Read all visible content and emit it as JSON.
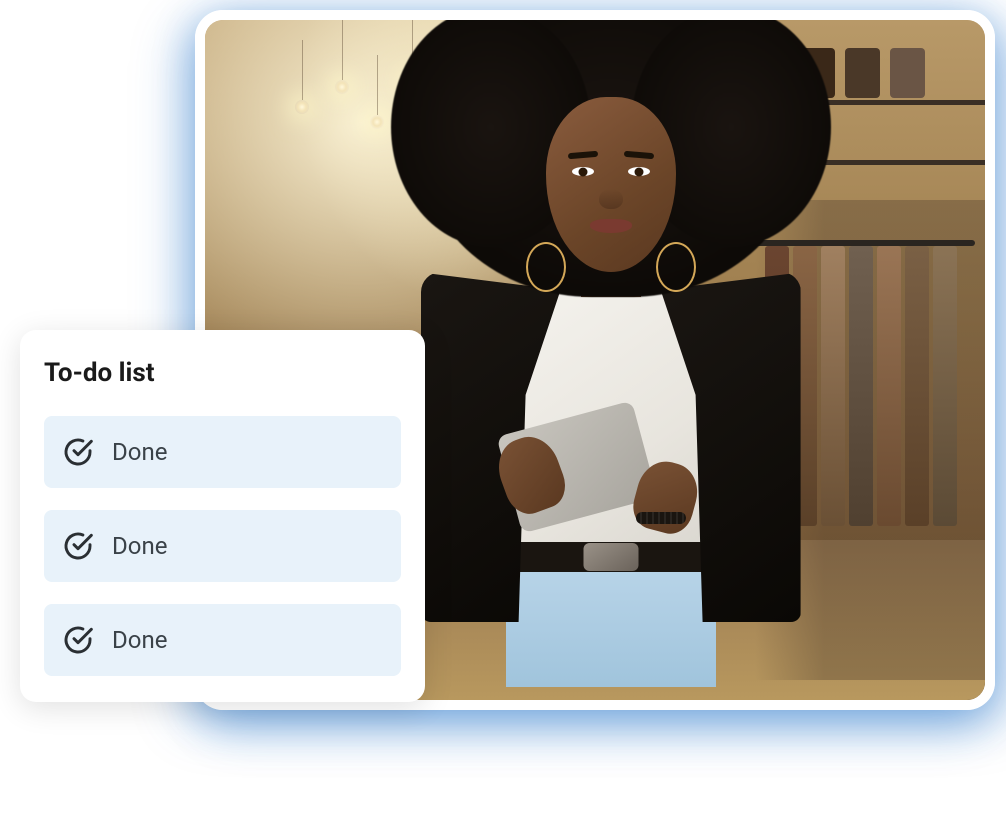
{
  "todo": {
    "title": "To-do list",
    "items": [
      {
        "label": "Done"
      },
      {
        "label": "Done"
      },
      {
        "label": "Done"
      }
    ]
  }
}
